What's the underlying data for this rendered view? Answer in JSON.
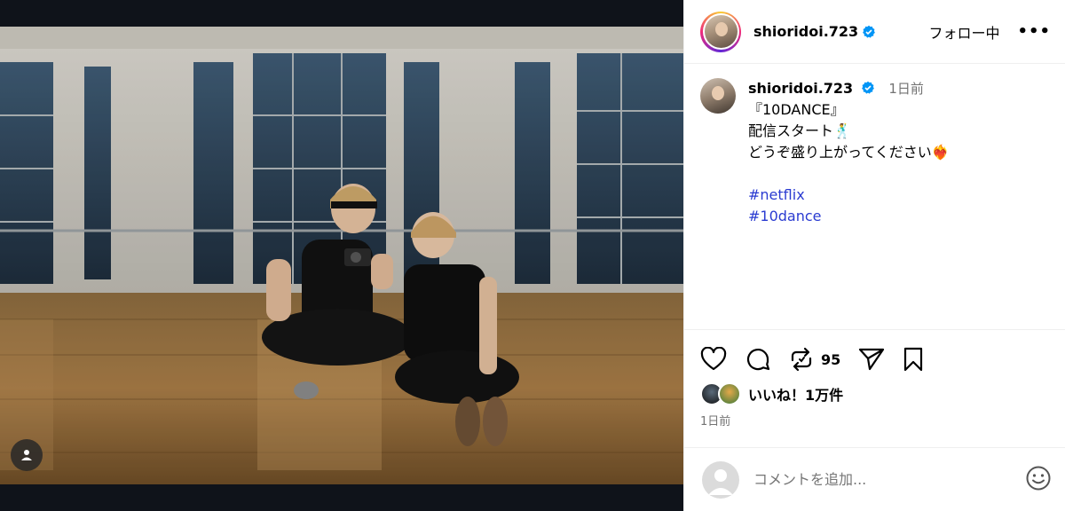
{
  "post": {
    "author": {
      "username": "shioridoi.723",
      "verified": true,
      "follow_status": "フォロー中"
    },
    "caption": {
      "username": "shioridoi.723",
      "time": "1日前",
      "lines": [
        "『10DANCE』",
        "配信スタート🕺",
        "どうぞ盛り上がってください❤️‍🔥"
      ],
      "hashtags": [
        "#netflix",
        "#10dance"
      ]
    },
    "actions": {
      "like_icon": "heart-icon",
      "comment_icon": "comment-icon",
      "repost_icon": "repost-icon",
      "repost_count": "95",
      "share_icon": "send-icon",
      "save_icon": "bookmark-icon"
    },
    "likes_text": "いいね！1万件",
    "date": "1日前",
    "comment_box": {
      "placeholder": "コメントを追加..."
    },
    "colors": {
      "hashtag": "#2a3bd1",
      "verified": "#0095f6",
      "muted": "#737373"
    }
  }
}
